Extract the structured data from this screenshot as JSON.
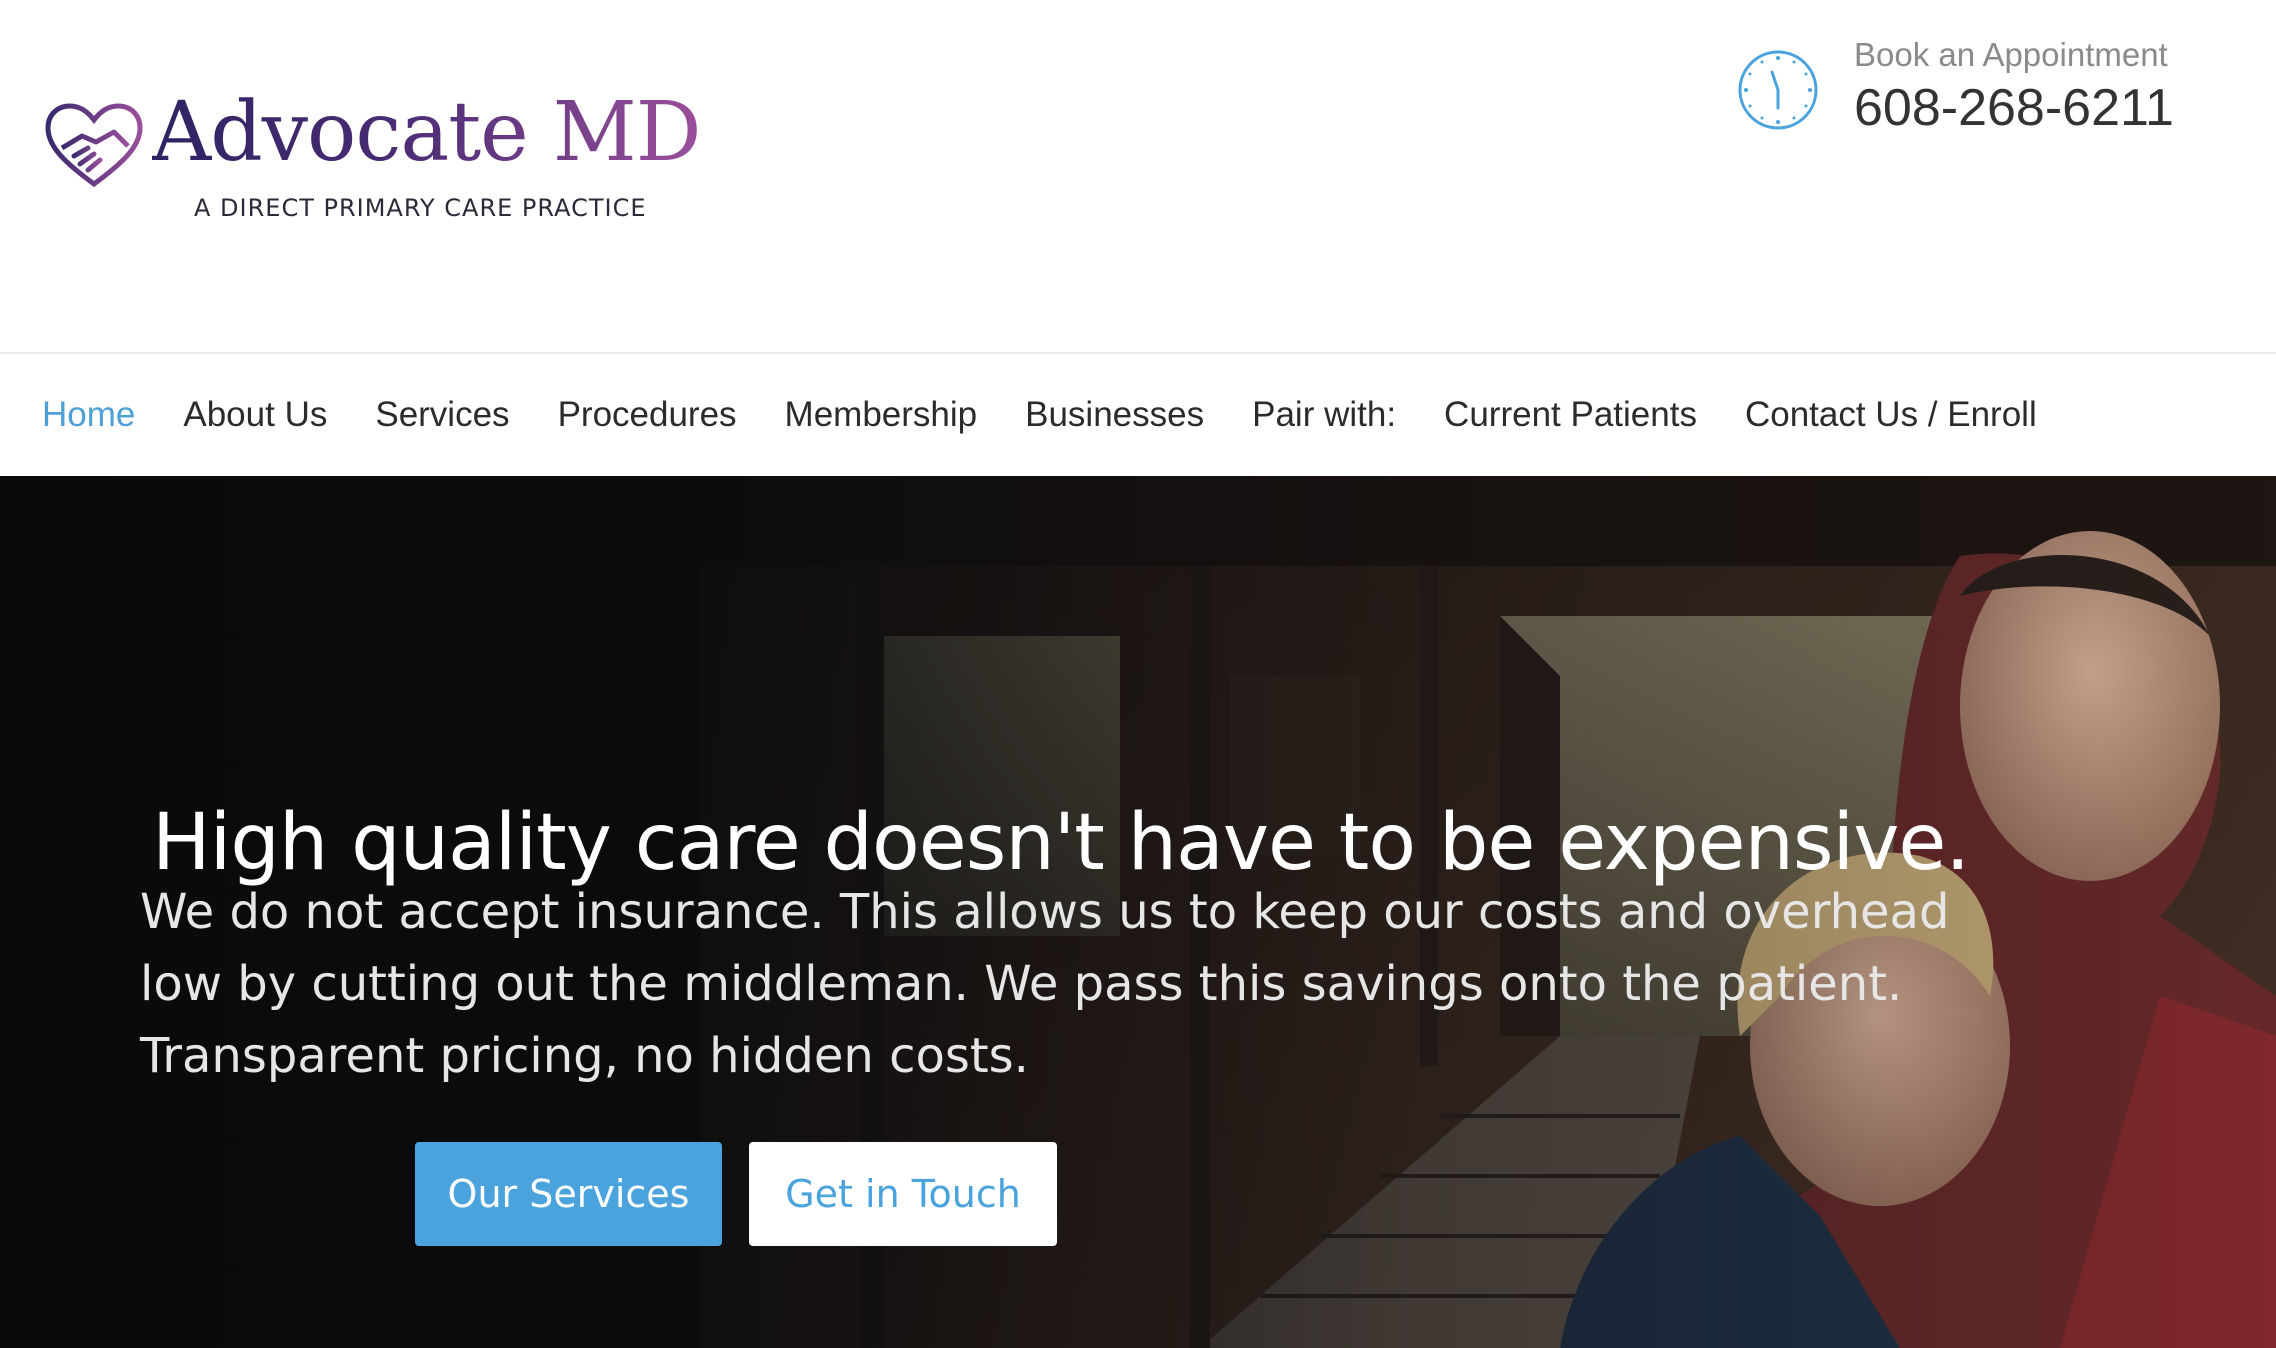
{
  "header": {
    "logo": {
      "name": "Advocate MD",
      "tagline": "A DIRECT PRIMARY CARE PRACTICE",
      "icon": "heart-handshake-icon"
    },
    "appointment": {
      "label": "Book an Appointment",
      "phone": "608-268-6211",
      "icon": "clock-icon"
    }
  },
  "nav": {
    "items": [
      {
        "label": "Home",
        "active": true
      },
      {
        "label": "About Us"
      },
      {
        "label": "Services"
      },
      {
        "label": "Procedures"
      },
      {
        "label": "Membership"
      },
      {
        "label": "Businesses"
      },
      {
        "label": "Pair with:"
      },
      {
        "label": "Current Patients"
      },
      {
        "label": "Contact Us / Enroll"
      }
    ]
  },
  "hero": {
    "title": "High quality care doesn't have to be expensive.",
    "text_lines": [
      "We do not accept insurance.  This allows us to keep our costs and overhead",
      "low by cutting out the middleman.  We pass this savings onto the patient.",
      "Transparent pricing, no hidden costs."
    ],
    "primary_button": "Our Services",
    "secondary_button": "Get in Touch"
  },
  "colors": {
    "accent": "#4aa3dd",
    "logo_dark": "#2f2362",
    "logo_purple": "#9a4f9c",
    "hero_bg": "#0f0f10"
  }
}
